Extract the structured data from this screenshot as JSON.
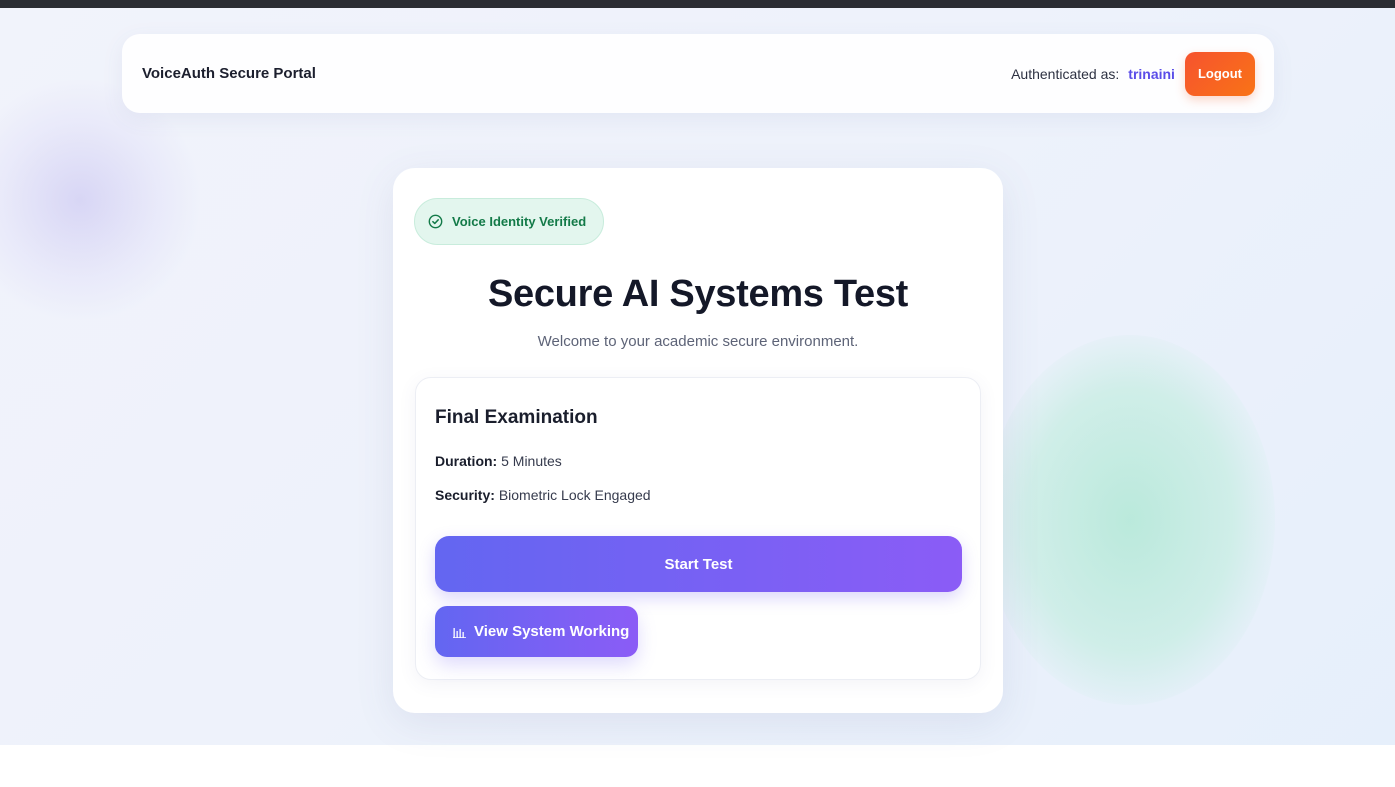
{
  "navbar": {
    "brand": "VoiceAuth Secure Portal",
    "auth_label": "Authenticated as:",
    "username": "trinaini",
    "logout_label": "Logout"
  },
  "card": {
    "badge": {
      "icon": "check-circle-icon",
      "label": "Voice Identity Verified"
    },
    "title": "Secure AI Systems Test",
    "subtitle": "Welcome to your academic secure environment.",
    "exam": {
      "title": "Final Examination",
      "duration_label": "Duration:",
      "duration_value": "5 Minutes",
      "security_label": "Security:",
      "security_value": "Biometric Lock Engaged",
      "start_label": "Start Test",
      "view_icon": "audio-bars-icon",
      "view_label": "View System Working"
    }
  },
  "colors": {
    "accent_start": "#6366f1",
    "accent_end": "#8b5cf6",
    "logout": "#f6532f",
    "verified_bg": "#e3f6ee",
    "verified_text": "#137a48",
    "username": "#5b4de8"
  }
}
